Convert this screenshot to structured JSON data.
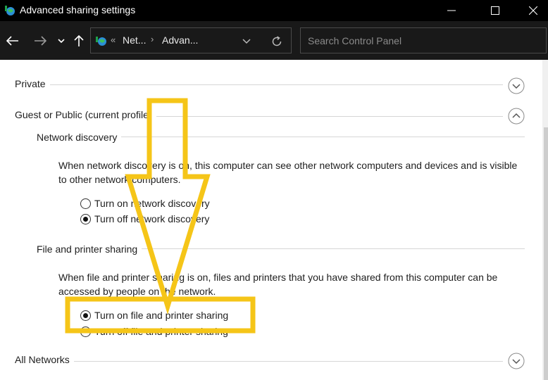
{
  "window": {
    "title": "Advanced sharing settings"
  },
  "navigation": {
    "breadcrumb_overflow": "«",
    "breadcrumbs": [
      "Net...",
      "Advan..."
    ],
    "breadcrumb_separator": "›",
    "search_placeholder": "Search Control Panel"
  },
  "sections": {
    "private": {
      "label": "Private",
      "expanded": false
    },
    "guest_public": {
      "label": "Guest or Public (current profile)",
      "expanded": true
    },
    "all_networks": {
      "label": "All Networks",
      "expanded": false
    }
  },
  "network_discovery": {
    "heading": "Network discovery",
    "description": "When network discovery is on, this computer can see other network computers and devices and is visible to other network computers.",
    "options": [
      {
        "label": "Turn on network discovery",
        "checked": false
      },
      {
        "label": "Turn off network discovery",
        "checked": true
      }
    ]
  },
  "file_printer_sharing": {
    "heading": "File and printer sharing",
    "description": "When file and printer sharing is on, files and printers that you have shared from this computer can be accessed by people on the network.",
    "options": [
      {
        "label": "Turn on file and printer sharing",
        "checked": true
      },
      {
        "label": "Turn off file and printer sharing",
        "checked": false
      }
    ]
  },
  "colors": {
    "titlebar": "#000000",
    "navbar": "#191919",
    "highlight": "#F5C518"
  },
  "icons": {
    "app": "network-globe-icon",
    "back": "arrow-left-icon",
    "forward": "arrow-right-icon",
    "recent": "chevron-down-icon",
    "up": "arrow-up-icon",
    "refresh": "refresh-icon",
    "expand": "chevron-down-circle-icon",
    "collapse": "chevron-up-circle-icon"
  }
}
